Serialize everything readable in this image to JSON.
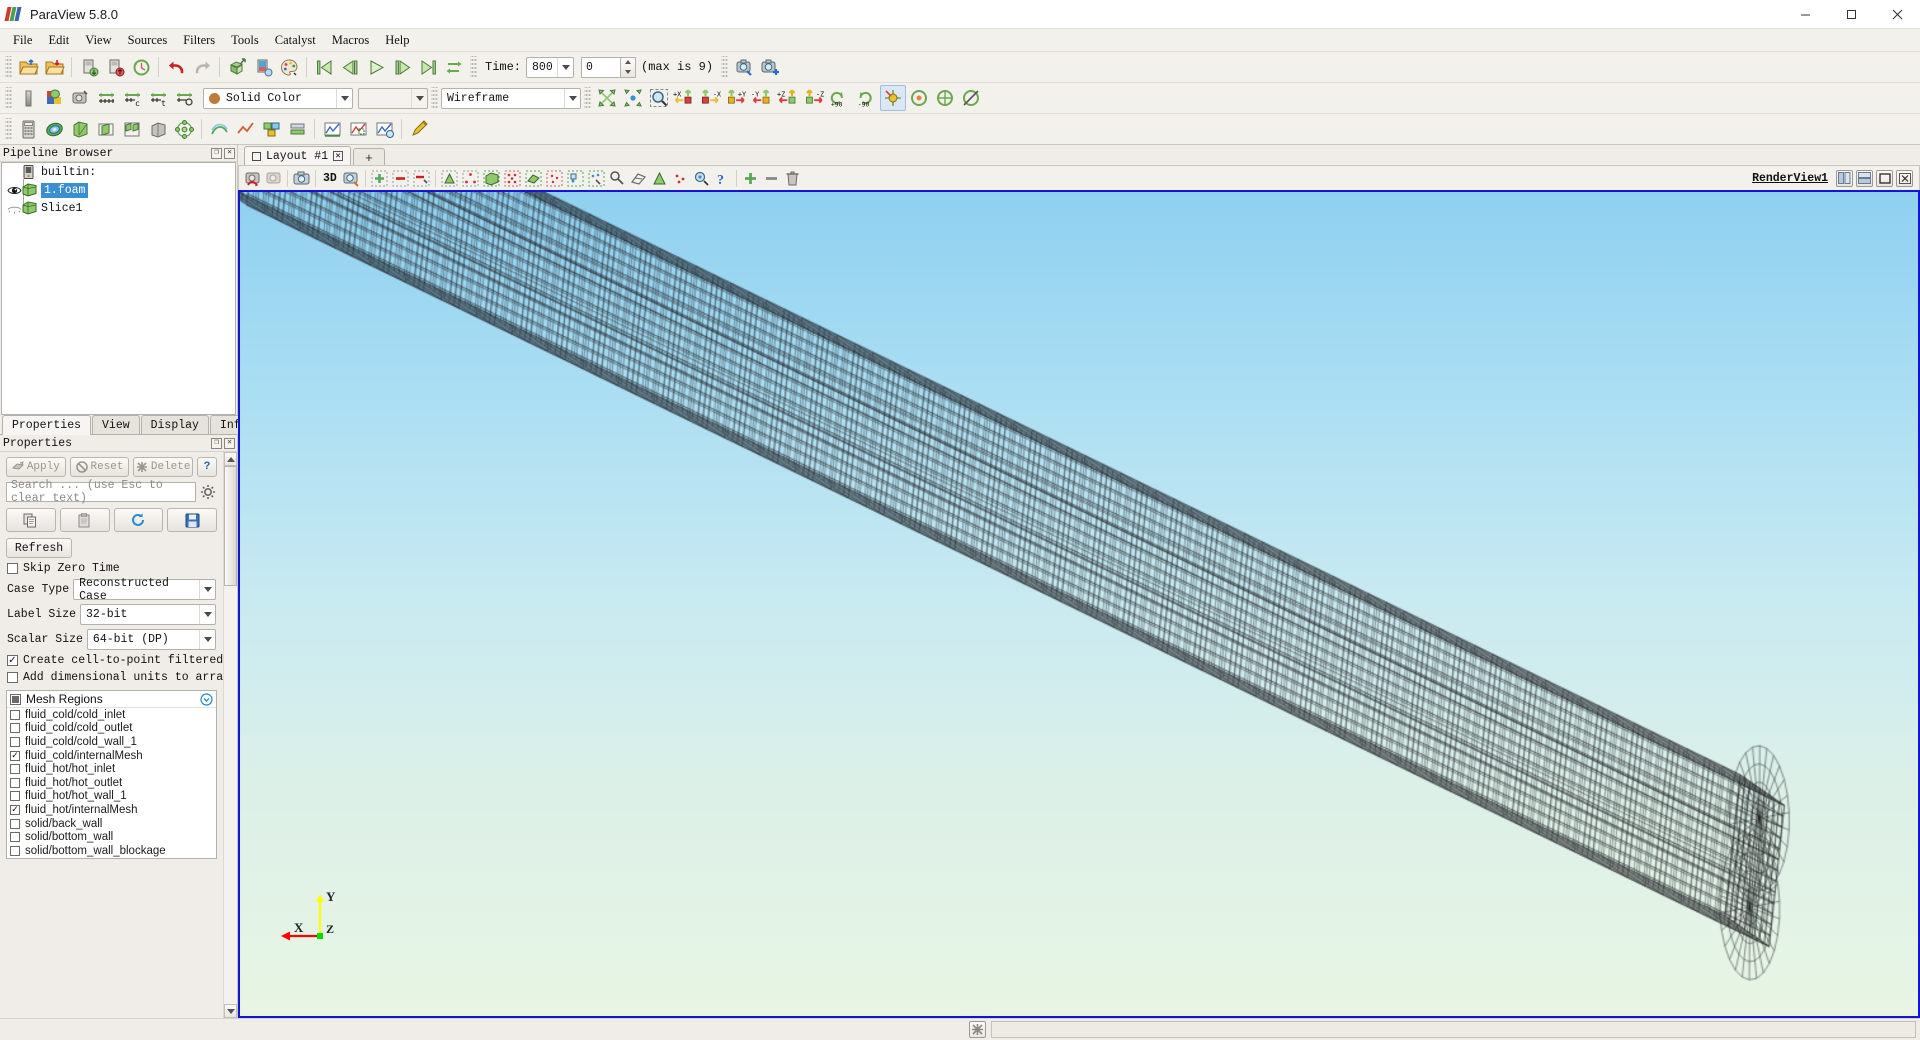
{
  "window": {
    "title": "ParaView 5.8.0",
    "minimize": "–",
    "maximize": "❐",
    "close": "✕"
  },
  "menubar": {
    "items": [
      {
        "label": "File"
      },
      {
        "label": "Edit"
      },
      {
        "label": "View"
      },
      {
        "label": "Sources"
      },
      {
        "label": "Filters"
      },
      {
        "label": "Tools"
      },
      {
        "label": "Catalyst"
      },
      {
        "label": "Macros"
      },
      {
        "label": "Help"
      }
    ]
  },
  "toolbar_main": {
    "time_label": "Time:",
    "time_value": "800",
    "frame_index": "0",
    "max_hint": "(max is 9)",
    "buttons": [
      {
        "name": "open-file-icon"
      },
      {
        "name": "recent-files-icon"
      },
      {
        "name": "save-data-icon"
      },
      {
        "name": "save-state-icon"
      },
      {
        "name": "load-state-icon"
      },
      {
        "name": "undo-icon"
      },
      {
        "name": "redo-icon"
      },
      {
        "name": "undo-camera-icon"
      },
      {
        "name": "redo-camera-icon"
      },
      {
        "name": "color-palette-icon"
      },
      {
        "name": "first-frame-icon"
      },
      {
        "name": "previous-frame-icon"
      },
      {
        "name": "play-icon"
      },
      {
        "name": "next-frame-icon"
      },
      {
        "name": "last-frame-icon"
      },
      {
        "name": "loop-icon"
      },
      {
        "name": "zoom-to-data-icon"
      },
      {
        "name": "add-camera-icon"
      }
    ]
  },
  "toolbar_repr": {
    "color_by": "Solid Color",
    "array_component": "",
    "representation": "Wireframe",
    "orientation_buttons": [
      {
        "label": "+X"
      },
      {
        "label": "-X"
      },
      {
        "label": "+Y"
      },
      {
        "label": "-Y"
      },
      {
        "label": "+Z"
      },
      {
        "label": "-Z"
      }
    ],
    "rotate_labels": [
      "+90",
      "-90"
    ]
  },
  "pipeline_browser": {
    "title": "Pipeline Browser",
    "items": [
      {
        "label": "builtin:",
        "icon": "server-icon",
        "visible": null,
        "selected": false,
        "depth": 0
      },
      {
        "label": "1.foam",
        "icon": "dataset-icon",
        "visible": true,
        "selected": true,
        "depth": 1
      },
      {
        "label": "Slice1",
        "icon": "dataset-icon",
        "visible": false,
        "selected": false,
        "depth": 1
      }
    ]
  },
  "properties_panel": {
    "tabs": [
      {
        "label": "Properties",
        "active": true
      },
      {
        "label": "View",
        "active": false
      },
      {
        "label": "Display",
        "active": false
      },
      {
        "label": "Information",
        "active": false
      }
    ],
    "title": "Properties",
    "apply_label": "Apply",
    "reset_label": "Reset",
    "delete_label": "Delete",
    "help_label": "?",
    "search_placeholder": "Search ... (use Esc to clear text)",
    "refresh_label": "Refresh",
    "skip_zero_time": {
      "label": "Skip Zero Time",
      "checked": false
    },
    "case_type": {
      "label": "Case Type",
      "value": "Reconstructed Case"
    },
    "label_size": {
      "label": "Label Size",
      "value": "32-bit"
    },
    "scalar_size": {
      "label": "Scalar Size",
      "value": "64-bit (DP)"
    },
    "create_cell_to_point": {
      "label": "Create cell-to-point filtered data",
      "checked": true
    },
    "add_dimensional_units": {
      "label": "Add dimensional units to array names",
      "checked": false
    },
    "mesh_regions": {
      "title": "Mesh Regions",
      "header_state": "partial",
      "items": [
        {
          "label": "fluid_cold/cold_inlet",
          "checked": false
        },
        {
          "label": "fluid_cold/cold_outlet",
          "checked": false
        },
        {
          "label": "fluid_cold/cold_wall_1",
          "checked": false
        },
        {
          "label": "fluid_cold/internalMesh",
          "checked": true
        },
        {
          "label": "fluid_hot/hot_inlet",
          "checked": false
        },
        {
          "label": "fluid_hot/hot_outlet",
          "checked": false
        },
        {
          "label": "fluid_hot/hot_wall_1",
          "checked": false
        },
        {
          "label": "fluid_hot/internalMesh",
          "checked": true
        },
        {
          "label": "solid/back_wall",
          "checked": false
        },
        {
          "label": "solid/bottom_wall",
          "checked": false
        },
        {
          "label": "solid/bottom_wall_blockage",
          "checked": false
        }
      ]
    }
  },
  "layout": {
    "tab_label": "Layout #1",
    "add_tab_label": "+",
    "view_toolbar": {
      "mode_3d": "3D",
      "buttons": [
        {
          "name": "interaction-mode-icon"
        },
        {
          "name": "camera-undo-icon"
        },
        {
          "name": "screenshot-icon"
        },
        {
          "name": "zoom-region-icon"
        },
        {
          "name": "add-selection-icon"
        },
        {
          "name": "subtract-selection-icon"
        },
        {
          "name": "toggle-selection-icon"
        },
        {
          "name": "select-cells-icon"
        },
        {
          "name": "select-points-icon"
        },
        {
          "name": "select-surface-cells-icon"
        },
        {
          "name": "select-surface-points-icon"
        },
        {
          "name": "frustum-cells-icon"
        },
        {
          "name": "frustum-points-icon"
        },
        {
          "name": "select-blocks-icon"
        },
        {
          "name": "interactive-select-icon"
        },
        {
          "name": "hover-cells-icon"
        },
        {
          "name": "hover-points-icon"
        },
        {
          "name": "help-selection-icon"
        },
        {
          "name": "grow-selection-icon"
        },
        {
          "name": "shrink-selection-icon"
        },
        {
          "name": "clear-selection-icon"
        }
      ]
    },
    "render_view_name": "RenderView1",
    "split_horizontal": "split-horizontal-icon",
    "split_vertical": "split-vertical-icon",
    "maximize_view": "maximize-view-icon",
    "close_view": "close-view-icon"
  },
  "render_view": {
    "axes": {
      "x_label": "X",
      "y_label": "Y",
      "z_label": "Z",
      "x_color": "#ff0000",
      "y_color": "#ffff00",
      "z_color": "#00cc00"
    },
    "background_top": "#8fd0f0",
    "background_bottom": "#e8f5e4",
    "mesh_color": "#222222",
    "representation": "Wireframe"
  },
  "statusbar": {
    "reset_button": "clear-icon",
    "message": ""
  }
}
